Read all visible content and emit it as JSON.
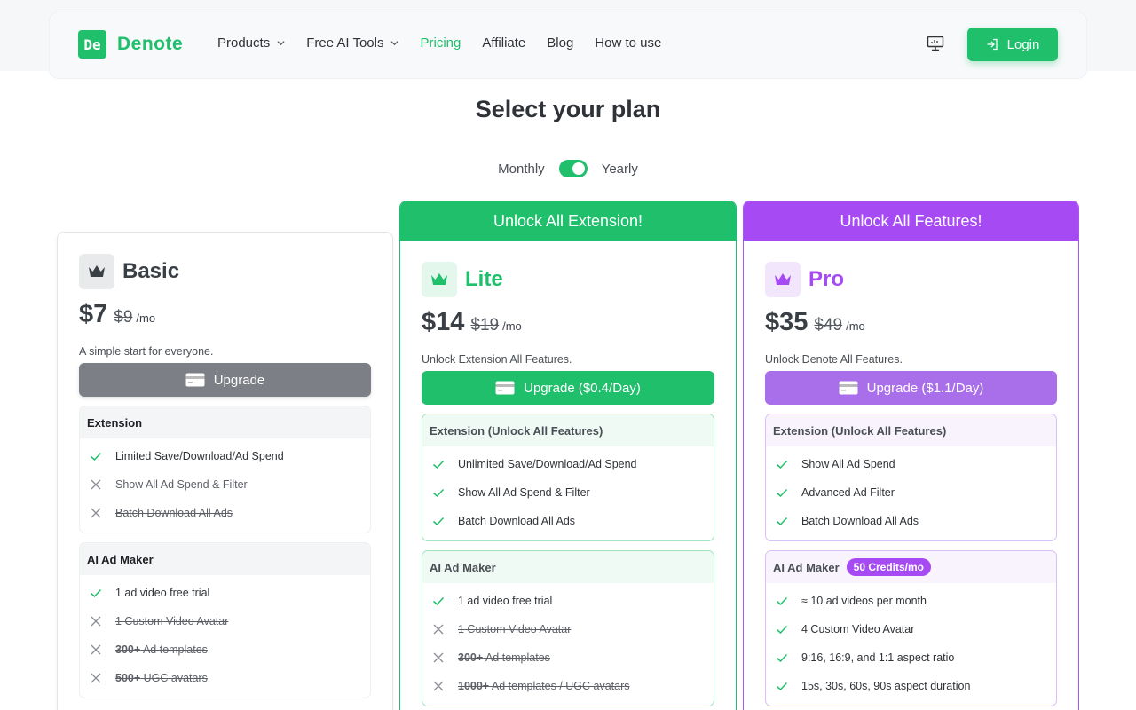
{
  "nav": {
    "logo_mark": "De",
    "logo_text": "Denote",
    "links": [
      {
        "label": "Products",
        "dropdown": true
      },
      {
        "label": "Free AI Tools",
        "dropdown": true
      },
      {
        "label": "Pricing",
        "active": true
      },
      {
        "label": "Affiliate"
      },
      {
        "label": "Blog"
      },
      {
        "label": "How to use"
      }
    ],
    "login_label": "Login"
  },
  "title": "Select your plan",
  "billing": {
    "monthly": "Monthly",
    "yearly": "Yearly",
    "yearly_selected": true
  },
  "colors": {
    "green": "#1fbf6b",
    "purple": "#a64bf4",
    "gray": "#7c7f85"
  },
  "plans": [
    {
      "name": "Basic",
      "price": "$7",
      "old_price": "$9",
      "per": "/mo",
      "desc": "A simple start for everyone.",
      "button": "Upgrade",
      "sections": [
        {
          "title": "Extension",
          "items": [
            {
              "text": "Limited Save/Download/Ad Spend",
              "on": true
            },
            {
              "text": "Show All Ad Spend & Filter",
              "on": false
            },
            {
              "text": "Batch Download All Ads",
              "on": false
            }
          ]
        },
        {
          "title": "AI Ad Maker",
          "items": [
            {
              "text": "1 ad video free trial",
              "on": true
            },
            {
              "text": "1 Custom Video Avatar",
              "on": false
            },
            {
              "strong": "300+",
              "text": "Ad templates",
              "on": false
            },
            {
              "strong": "500+",
              "text": "UGC avatars",
              "on": false
            }
          ]
        }
      ]
    },
    {
      "banner": "Unlock All Extension!",
      "name": "Lite",
      "price": "$14",
      "old_price": "$19",
      "per": "/mo",
      "desc": "Unlock Extension All Features.",
      "button": "Upgrade ($0.4/Day)",
      "sections": [
        {
          "title": "Extension (Unlock All Features)",
          "items": [
            {
              "text": "Unlimited Save/Download/Ad Spend",
              "on": true
            },
            {
              "text": "Show All Ad Spend & Filter",
              "on": true
            },
            {
              "text": "Batch Download All Ads",
              "on": true
            }
          ]
        },
        {
          "title": "AI Ad Maker",
          "items": [
            {
              "text": "1 ad video free trial",
              "on": true
            },
            {
              "text": "1 Custom Video Avatar",
              "on": false
            },
            {
              "strong": "300+",
              "text": "Ad templates",
              "on": false
            },
            {
              "strong": "1000+",
              "text": "Ad templates / UGC avatars",
              "on": false
            }
          ]
        }
      ]
    },
    {
      "banner": "Unlock All Features!",
      "name": "Pro",
      "price": "$35",
      "old_price": "$49",
      "per": "/mo",
      "desc": "Unlock Denote All Features.",
      "button": "Upgrade ($1.1/Day)",
      "sections": [
        {
          "title": "Extension (Unlock All Features)",
          "items": [
            {
              "text": "Show All Ad Spend",
              "on": true
            },
            {
              "text": "Advanced Ad Filter",
              "on": true
            },
            {
              "text": "Batch Download All Ads",
              "on": true
            }
          ]
        },
        {
          "title": "AI Ad Maker",
          "badge": "50 Credits/mo",
          "items": [
            {
              "text": "≈ 10 ad videos per month",
              "on": true
            },
            {
              "text": "4 Custom Video Avatar",
              "on": true
            },
            {
              "text": "9:16, 16:9, and 1:1 aspect ratio",
              "on": true
            },
            {
              "text": "15s, 30s, 60s, 90s aspect duration",
              "on": true
            }
          ]
        }
      ]
    }
  ]
}
